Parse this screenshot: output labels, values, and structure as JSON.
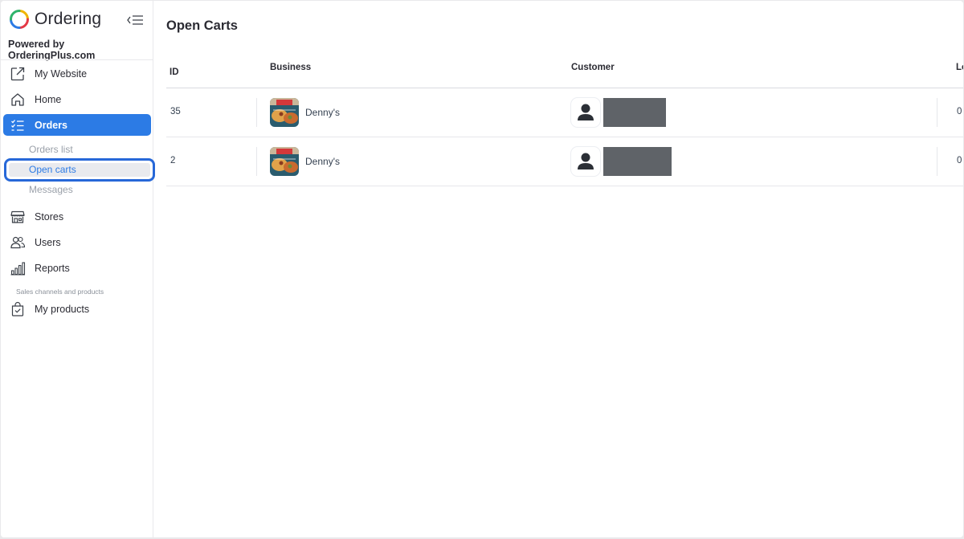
{
  "sidebar": {
    "brand_name": "Ordering",
    "powered_by": "Powered by OrderingPlus.com",
    "items": [
      {
        "label": "My Website",
        "icon": "external-link-icon"
      },
      {
        "label": "Home",
        "icon": "home-icon"
      },
      {
        "label": "Orders",
        "icon": "list-check-icon",
        "active": true
      },
      {
        "label": "Stores",
        "icon": "shop-icon"
      },
      {
        "label": "Users",
        "icon": "users-icon"
      },
      {
        "label": "Reports",
        "icon": "bar-chart-icon"
      },
      {
        "label": "My products",
        "icon": "bag-check-icon"
      }
    ],
    "orders_sub": [
      "Orders list",
      "Open carts",
      "Messages"
    ],
    "section_label": "Sales channels and products"
  },
  "main": {
    "title": "Open Carts",
    "columns": [
      "ID",
      "Business",
      "Customer",
      "Lo"
    ],
    "rows": [
      {
        "id": "35",
        "business": "Denny's",
        "last": "0"
      },
      {
        "id": "2",
        "business": "Denny's",
        "last": "0"
      }
    ]
  },
  "colors": {
    "accent": "#2c7be5",
    "highlight_border": "#2768d8",
    "redaction": "#5f6368"
  }
}
